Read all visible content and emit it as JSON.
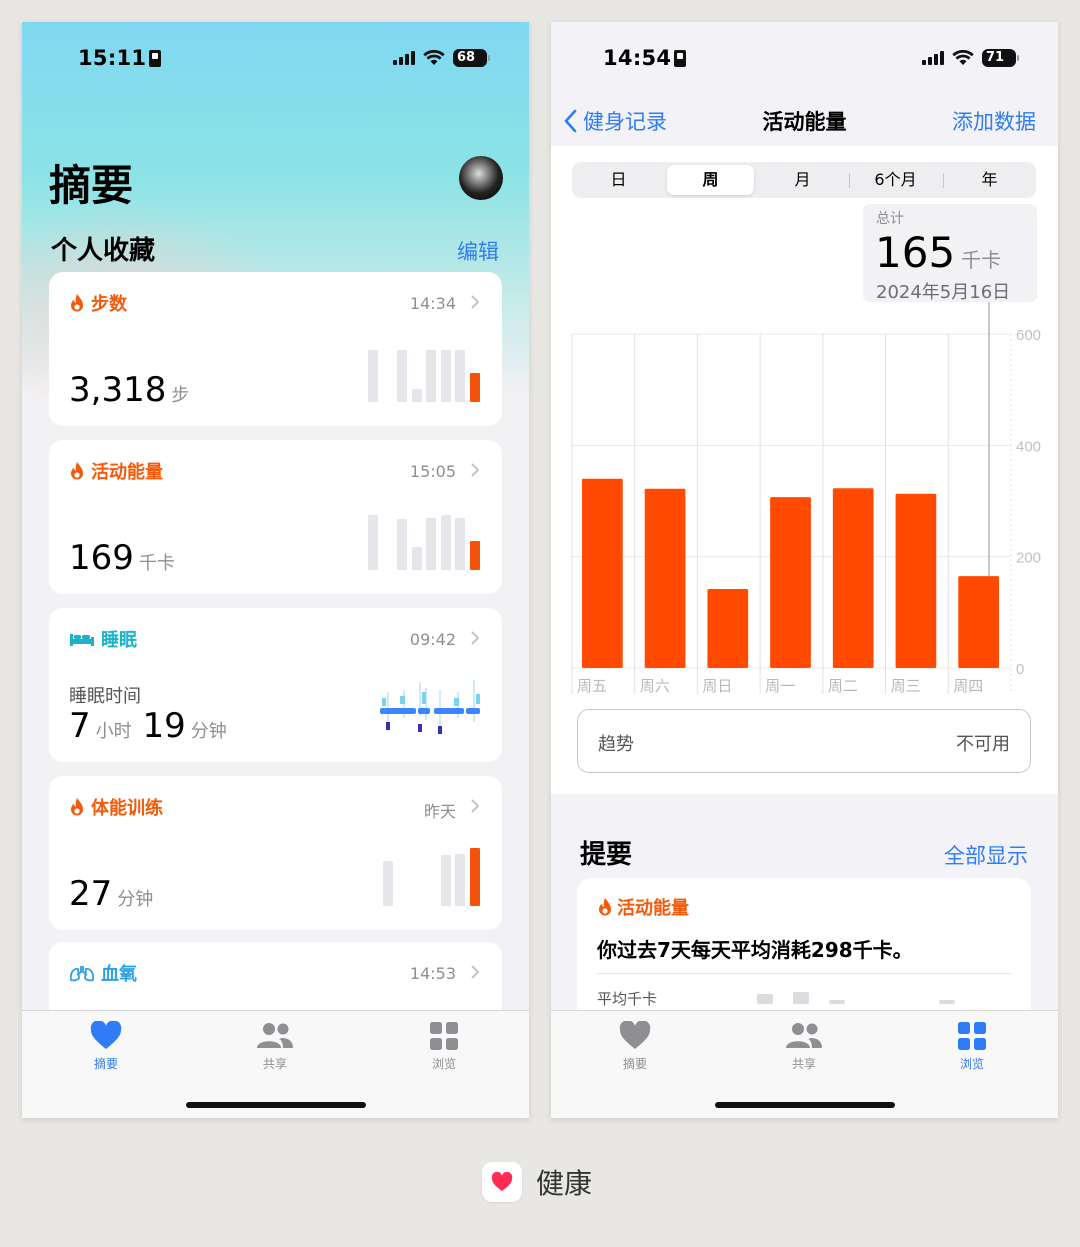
{
  "left_phone": {
    "status": {
      "time": "15:11",
      "battery": "68"
    },
    "title": "摘要",
    "favorites": {
      "title": "个人收藏",
      "edit": "编辑"
    },
    "cards": [
      {
        "title": "步数",
        "time": "14:34",
        "value": "3,318",
        "unit": "步",
        "color": "#f35a0a",
        "bars": [
          0.9,
          0.0,
          0.9,
          0.22,
          0.9,
          0.9,
          0.9,
          0.5
        ],
        "highlight": 7
      },
      {
        "title": "活动能量",
        "time": "15:05",
        "value": "169",
        "unit": "千卡",
        "color": "#f35a0a",
        "bars": [
          0.95,
          0.0,
          0.88,
          0.4,
          0.9,
          0.95,
          0.9,
          0.5
        ],
        "highlight": 7
      },
      {
        "title": "睡眠",
        "time": "09:42",
        "subtitle": "睡眠时间",
        "value_h": "7",
        "unit_h": "小时",
        "value_m": "19",
        "unit_m": "分钟",
        "color": "#1ab3c9"
      },
      {
        "title": "体能训练",
        "time": "昨天",
        "value": "27",
        "unit": "分钟",
        "color": "#f35a0a",
        "bars": [
          0.78,
          0.0,
          0.0,
          0.0,
          0.88,
          0.9,
          1.0
        ],
        "highlight": 6
      },
      {
        "title": "血氧",
        "time": "14:53",
        "color": "#2ba0e6"
      }
    ],
    "tabs": [
      {
        "label": "摘要",
        "icon": "heart-icon",
        "active": true
      },
      {
        "label": "共享",
        "icon": "people-icon",
        "active": false
      },
      {
        "label": "浏览",
        "icon": "grid-icon",
        "active": false
      }
    ]
  },
  "right_phone": {
    "status": {
      "time": "14:54",
      "battery": "71"
    },
    "nav": {
      "back": "健身记录",
      "title": "活动能量",
      "action": "添加数据"
    },
    "segments": [
      "日",
      "周",
      "月",
      "6个月",
      "年"
    ],
    "selected_segment": 1,
    "tooltip": {
      "label": "总计",
      "value": "165",
      "unit": "千卡",
      "date": "2024年5月16日"
    },
    "trend": {
      "label": "趋势",
      "value": "不可用"
    },
    "highlights": {
      "title": "提要",
      "show_all": "全部显示",
      "card_title": "活动能量",
      "text": "你过去7天每天平均消耗298千卡。",
      "sub_label": "平均千卡"
    },
    "tabs": [
      {
        "label": "摘要",
        "icon": "heart-icon",
        "active": false
      },
      {
        "label": "共享",
        "icon": "people-icon",
        "active": false
      },
      {
        "label": "浏览",
        "icon": "grid-icon",
        "active": true
      }
    ]
  },
  "chart_data": {
    "type": "bar",
    "categories": [
      "周五",
      "周六",
      "周日",
      "周一",
      "周二",
      "周三",
      "周四"
    ],
    "values": [
      340,
      322,
      142,
      307,
      323,
      313,
      165
    ],
    "ylim": [
      0,
      600
    ],
    "yticks": [
      "0",
      "200",
      "400",
      "600"
    ],
    "selected_index": 6,
    "bar_color": "#ff4a00",
    "grid": true
  },
  "app": {
    "name": "健康",
    "icon": "health-heart-icon",
    "accent": "#ff2d55"
  }
}
